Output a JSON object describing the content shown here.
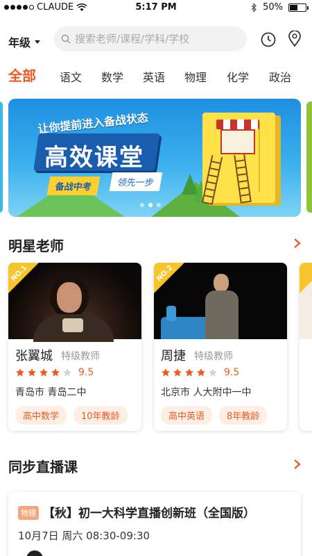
{
  "status_bar": {
    "carrier": "CLAUDE",
    "time": "5:17 PM",
    "battery": "50%",
    "battery_level": 0.5
  },
  "header": {
    "grade_label": "年级",
    "search_placeholder": "搜索老师/课程/学科/学校",
    "icons": [
      "clock-icon",
      "location-pin-icon"
    ]
  },
  "tabs": [
    {
      "label": "全部",
      "active": true
    },
    {
      "label": "语文",
      "active": false
    },
    {
      "label": "数学",
      "active": false
    },
    {
      "label": "英语",
      "active": false
    },
    {
      "label": "物理",
      "active": false
    },
    {
      "label": "化学",
      "active": false
    },
    {
      "label": "政治",
      "active": false
    }
  ],
  "banner": {
    "slogan": "让你提前进入备战状态",
    "title": "高效课堂",
    "ribbon_left": "备战中考",
    "ribbon_right": "领先一步",
    "page_count": 3,
    "active_page": 1
  },
  "star_teachers": {
    "title": "明星老师",
    "teachers": [
      {
        "badge": "NO.1",
        "name": "张翼城",
        "rank": "特级教师",
        "rating": 4,
        "score": "9.5",
        "location": "青岛市 青岛二中",
        "tags": [
          "高中数学",
          "10年教龄"
        ]
      },
      {
        "badge": "NO.2",
        "name": "周捷",
        "rank": "特级教师",
        "rating": 4,
        "score": "9.5",
        "location": "北京市 人大附中一中",
        "tags": [
          "高中英语",
          "8年教龄"
        ]
      }
    ]
  },
  "live_courses": {
    "title": "同步直播课",
    "courses": [
      {
        "subject_tag": "物理",
        "title": "【秋】初一大科学直播创新班（全国版）",
        "time": "10月7日 周六 08:30-09:30"
      }
    ]
  },
  "colors": {
    "accent": "#f05a22",
    "badge": "#f7c52b",
    "tag_bg": "#fdeee6"
  }
}
